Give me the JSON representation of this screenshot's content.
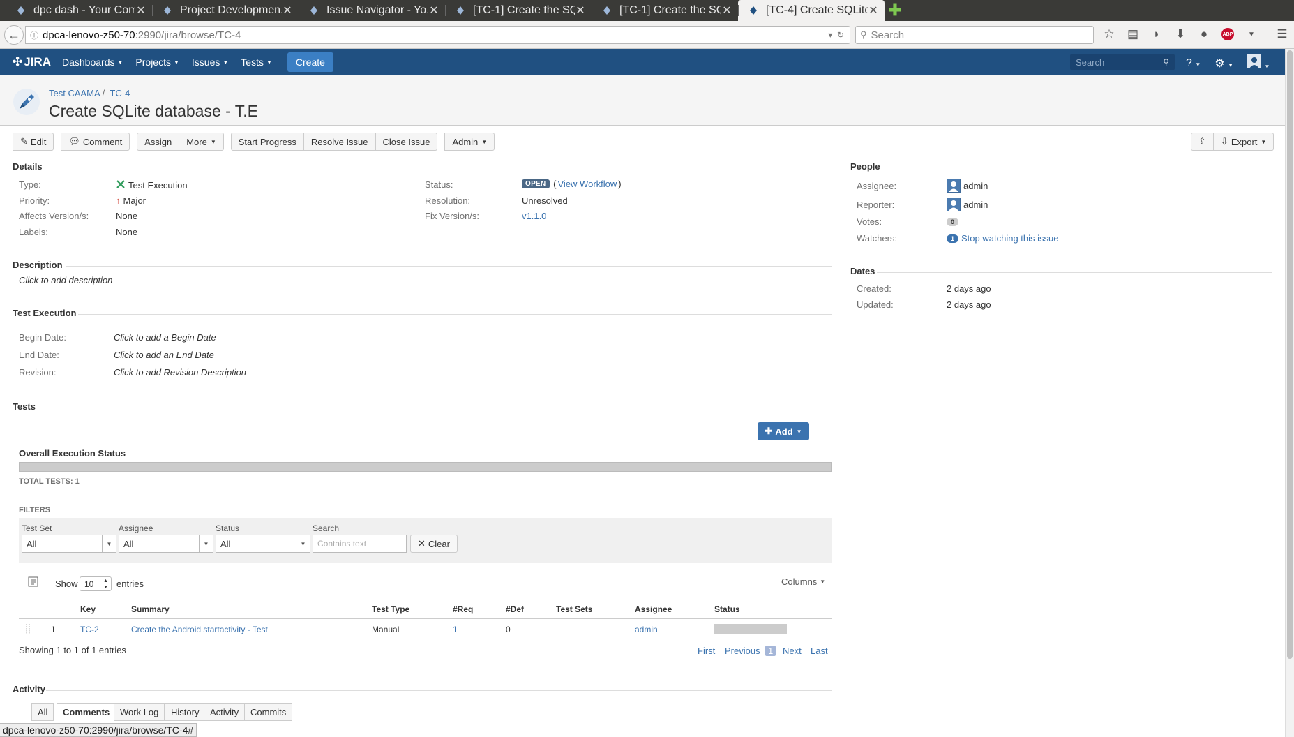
{
  "browser": {
    "tabs": [
      {
        "title": "dpc dash - Your Com..."
      },
      {
        "title": "Project Developmen..."
      },
      {
        "title": "Issue Navigator - Yo..."
      },
      {
        "title": "[TC-1] Create the SQ..."
      },
      {
        "title": "[TC-1] Create the SQ..."
      },
      {
        "title": "[TC-4] Create SQLite..."
      }
    ],
    "url_host": "dpca-lenovo-z50-70",
    "url_path": ":2990/jira/browse/TC-4",
    "search_placeholder": "Search",
    "status_url": "dpca-lenovo-z50-70:2990/jira/browse/TC-4#"
  },
  "jira": {
    "logo": "JIRA",
    "nav": [
      "Dashboards",
      "Projects",
      "Issues",
      "Tests"
    ],
    "create_label": "Create",
    "search_placeholder": "Search"
  },
  "issue": {
    "project": "Test CAAMA",
    "key": "TC-4",
    "title": "Create SQLite database - T.E"
  },
  "toolbar": {
    "edit": "Edit",
    "comment": "Comment",
    "assign": "Assign",
    "more": "More",
    "start_progress": "Start Progress",
    "resolve_issue": "Resolve Issue",
    "close_issue": "Close Issue",
    "admin": "Admin",
    "export": "Export"
  },
  "details": {
    "title": "Details",
    "type_label": "Type:",
    "type_value": "Test Execution",
    "priority_label": "Priority:",
    "priority_value": "Major",
    "affects_label": "Affects Version/s:",
    "affects_value": "None",
    "labels_label": "Labels:",
    "labels_value": "None",
    "status_label": "Status:",
    "status_value": "OPEN",
    "view_workflow": "View Workflow",
    "resolution_label": "Resolution:",
    "resolution_value": "Unresolved",
    "fix_label": "Fix Version/s:",
    "fix_value": "v1.1.0"
  },
  "description": {
    "title": "Description",
    "placeholder": "Click to add description"
  },
  "test_execution": {
    "title": "Test Execution",
    "begin_label": "Begin Date:",
    "begin_value": "Click to add a Begin Date",
    "end_label": "End Date:",
    "end_value": "Click to add an End Date",
    "revision_label": "Revision:",
    "revision_value": "Click to add Revision Description"
  },
  "tests": {
    "title": "Tests",
    "add_label": "Add",
    "overall_status": "Overall Execution Status",
    "total_tests": "TOTAL TESTS: 1",
    "filters_title": "FILTERS",
    "filters": {
      "test_set_label": "Test Set",
      "test_set_value": "All",
      "assignee_label": "Assignee",
      "assignee_value": "All",
      "status_label": "Status",
      "status_value": "All",
      "search_label": "Search",
      "search_placeholder": "Contains text",
      "clear_label": "Clear"
    },
    "show_label": "Show",
    "entries_count": "10",
    "entries_label": "entries",
    "columns_label": "Columns",
    "headers": [
      "Key",
      "Summary",
      "Test Type",
      "#Req",
      "#Def",
      "Test Sets",
      "Assignee",
      "Status"
    ],
    "rows": [
      {
        "index": "1",
        "key": "TC-2",
        "summary": "Create the Android startactivity - Test",
        "test_type": "Manual",
        "req": "1",
        "def": "0",
        "test_sets": "",
        "assignee": "admin"
      }
    ],
    "showing": "Showing 1 to 1 of 1 entries",
    "pagination": {
      "first": "First",
      "previous": "Previous",
      "current": "1",
      "next": "Next",
      "last": "Last"
    }
  },
  "activity": {
    "title": "Activity",
    "tabs": [
      "All",
      "Comments",
      "Work Log",
      "History",
      "Activity",
      "Commits"
    ]
  },
  "people": {
    "title": "People",
    "assignee_label": "Assignee:",
    "assignee_value": "admin",
    "reporter_label": "Reporter:",
    "reporter_value": "admin",
    "votes_label": "Votes:",
    "votes_value": "0",
    "watchers_label": "Watchers:",
    "watchers_count": "1",
    "watch_link": "Stop watching this issue"
  },
  "dates": {
    "title": "Dates",
    "created_label": "Created:",
    "created_value": "2 days ago",
    "updated_label": "Updated:",
    "updated_value": "2 days ago"
  },
  "colors": {
    "header": "#205081",
    "link": "#3b73af",
    "status_lozenge": "#4a6785"
  }
}
